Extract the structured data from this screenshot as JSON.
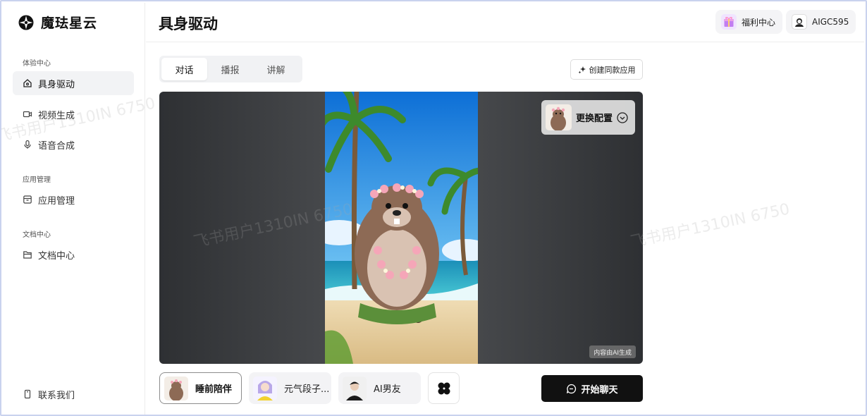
{
  "app": {
    "name": "魔珐星云"
  },
  "sidebar": {
    "groups": [
      {
        "title": "体验中心",
        "items": [
          {
            "label": "具身驱动",
            "icon": "home-icon"
          },
          {
            "label": "视频生成",
            "icon": "video-camera-icon"
          },
          {
            "label": "语音合成",
            "icon": "microphone-icon"
          }
        ]
      },
      {
        "title": "应用管理",
        "items": [
          {
            "label": "应用管理",
            "icon": "app-box-icon"
          }
        ]
      },
      {
        "title": "文档中心",
        "items": [
          {
            "label": "文档中心",
            "icon": "folder-icon"
          }
        ]
      }
    ],
    "contact": {
      "label": "联系我们",
      "icon": "phone-icon"
    }
  },
  "header": {
    "title": "具身驱动",
    "welfare": {
      "label": "福利中心",
      "icon": "gift-icon"
    },
    "user": {
      "name": "AIGC595",
      "icon": "avatar-icon"
    }
  },
  "tabs": [
    {
      "label": "对话",
      "active": true
    },
    {
      "label": "播报",
      "active": false
    },
    {
      "label": "讲解",
      "active": false
    }
  ],
  "create_button": {
    "label": "创建同款应用",
    "icon": "sparkle-icon"
  },
  "stage": {
    "config_label": "更换配置",
    "ai_badge": "内容由AI生成"
  },
  "characters": [
    {
      "label": "睡前陪伴",
      "active": true
    },
    {
      "label": "元气段子...",
      "active": false
    },
    {
      "label": "AI男友",
      "active": false
    }
  ],
  "more_icon": "four-leaf-icon",
  "start_button": {
    "label": "开始聊天",
    "icon": "chat-bubble-icon"
  },
  "watermark": "飞书用户1310IN 6750",
  "colors": {
    "accent": "#111111",
    "active_bg": "#f2f3f5",
    "sky": "#1f8ee0",
    "sand": "#e6cfa0"
  }
}
